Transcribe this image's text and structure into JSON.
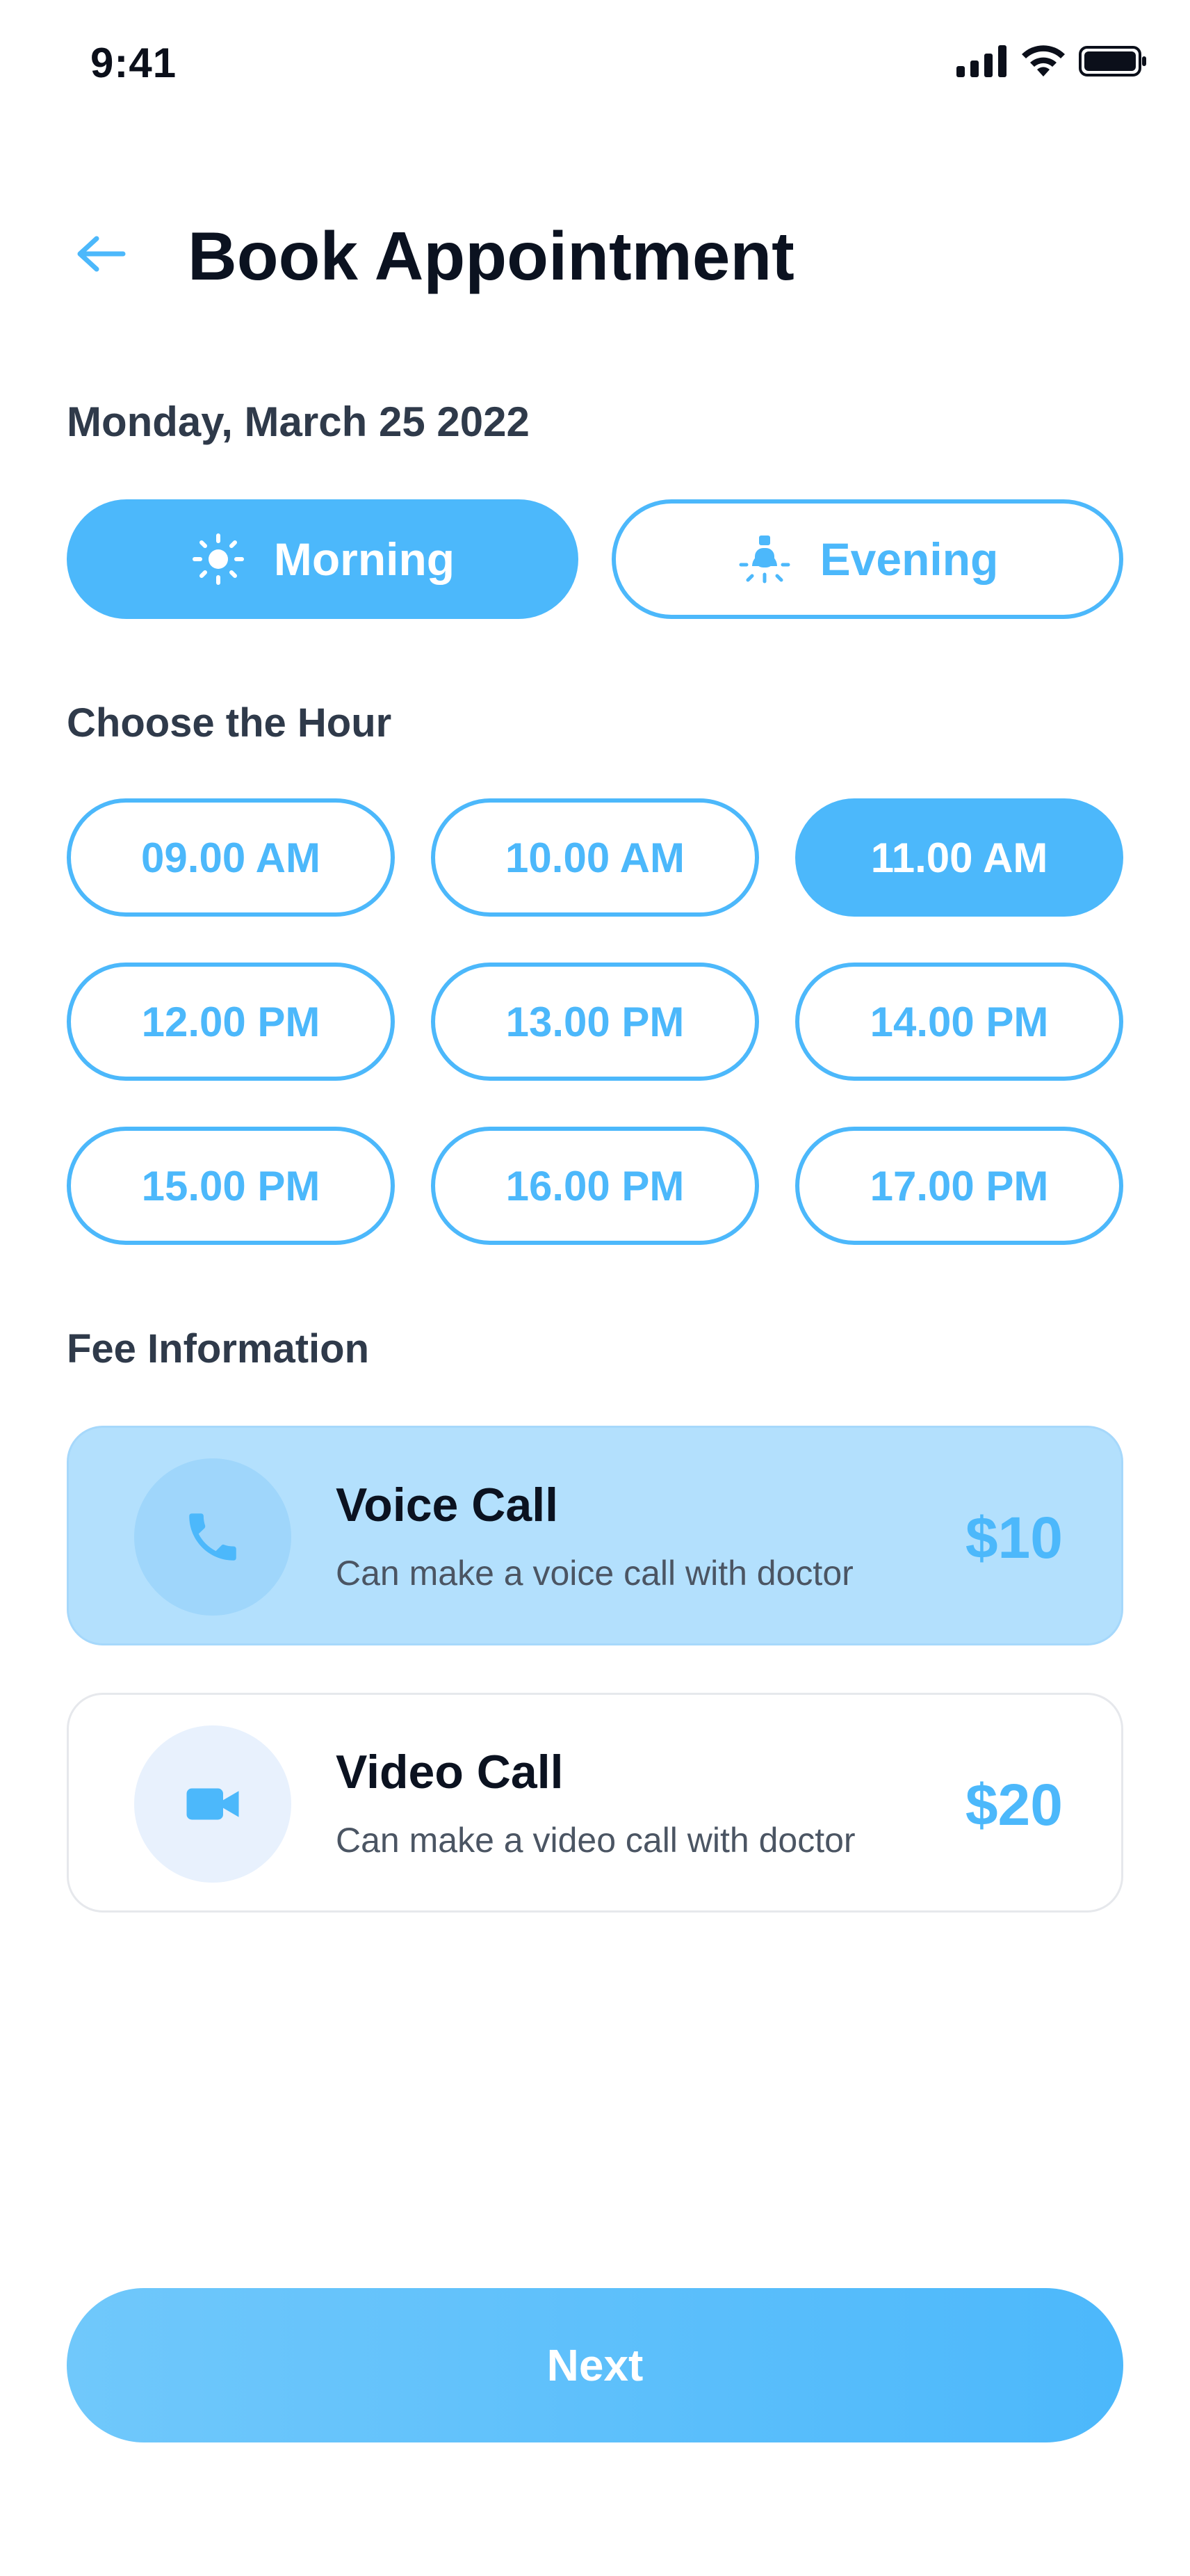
{
  "status_bar": {
    "time": "9:41"
  },
  "header": {
    "back_icon": "arrow-left-icon",
    "title": "Book Appointment"
  },
  "date": {
    "label": "Monday, March 25 2022"
  },
  "time_of_day": {
    "selected": "Morning",
    "options": [
      {
        "label": "Morning",
        "icon": "sun-icon"
      },
      {
        "label": "Evening",
        "icon": "lamp-icon"
      }
    ]
  },
  "hours": {
    "section_label": "Choose the Hour",
    "selected": "11.00 AM",
    "slots": [
      "09.00 AM",
      "10.00 AM",
      "11.00 AM",
      "12.00 PM",
      "13.00 PM",
      "14.00 PM",
      "15.00 PM",
      "16.00 PM",
      "17.00 PM"
    ]
  },
  "fees": {
    "section_label": "Fee Information",
    "items": [
      {
        "title": "Voice Call",
        "description": "Can make a voice call with doctor",
        "price": "$10",
        "icon": "phone-icon",
        "selected": true
      },
      {
        "title": "Video Call",
        "description": "Can make a video call with doctor",
        "price": "$20",
        "icon": "video-camera-icon",
        "selected": false
      }
    ]
  },
  "footer": {
    "next_label": "Next"
  },
  "colors": {
    "accent": "#4cb8fb",
    "selected_card": "#b3e0fd",
    "text_dark": "#0b1220",
    "text_muted": "#4b5563"
  }
}
